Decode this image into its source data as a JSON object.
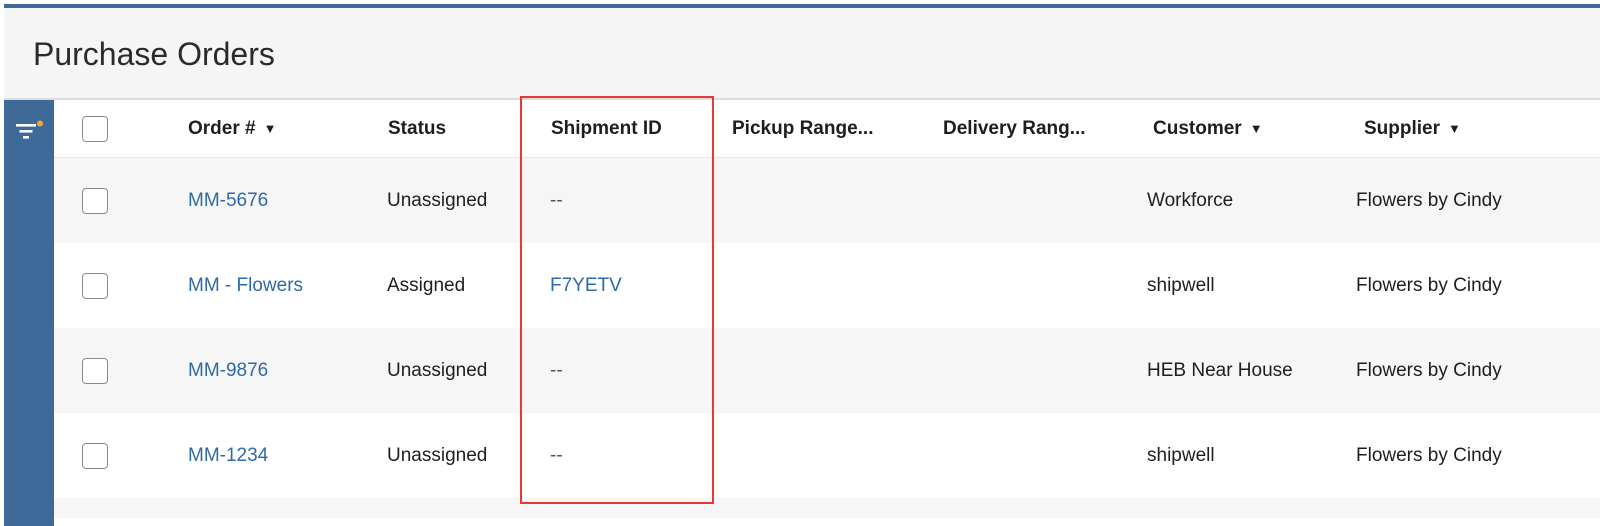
{
  "page": {
    "title": "Purchase Orders"
  },
  "colors": {
    "accent": "#3d6a98",
    "link": "#2f6aa6",
    "highlight": "#e53935",
    "filter_dot": "#f0a830"
  },
  "sidebar": {
    "filter_icon": "filter-icon"
  },
  "columns": {
    "order": "Order #",
    "status": "Status",
    "shipment": "Shipment ID",
    "pickup": "Pickup Range...",
    "delivery": "Delivery Rang...",
    "customer": "Customer",
    "supplier": "Supplier"
  },
  "rows": [
    {
      "order": "MM-5676",
      "status": "Unassigned",
      "shipment": "--",
      "pickup": "",
      "delivery": "",
      "customer": "Workforce",
      "supplier": "Flowers by Cindy"
    },
    {
      "order": "MM - Flowers",
      "status": "Assigned",
      "shipment": "F7YETV",
      "pickup": "",
      "delivery": "",
      "customer": "shipwell",
      "supplier": "Flowers by Cindy"
    },
    {
      "order": "MM-9876",
      "status": "Unassigned",
      "shipment": "--",
      "pickup": "",
      "delivery": "",
      "customer": "HEB Near House",
      "supplier": "Flowers by Cindy"
    },
    {
      "order": "MM-1234",
      "status": "Unassigned",
      "shipment": "--",
      "pickup": "",
      "delivery": "",
      "customer": "shipwell",
      "supplier": "Flowers by Cindy"
    }
  ]
}
